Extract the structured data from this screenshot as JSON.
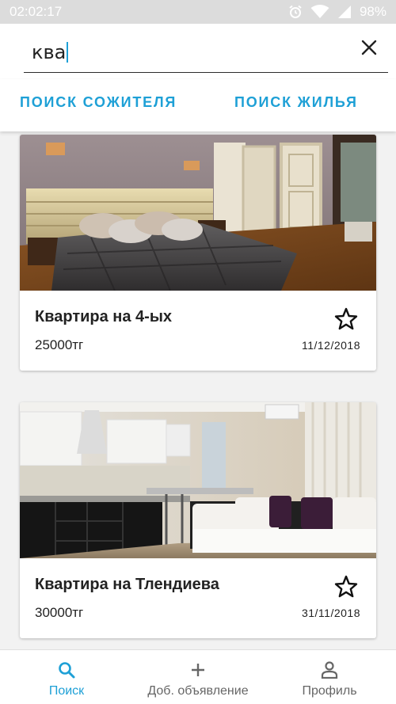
{
  "status_bar": {
    "time": "02:02:17",
    "battery": "98%",
    "icons": [
      "alarm-icon",
      "wifi-icon",
      "signal-icon",
      "battery-icon"
    ]
  },
  "search": {
    "value": "ква",
    "clear_icon": "close-icon"
  },
  "tabs": {
    "roommate": "Поиск сожителя",
    "housing": "Поиск жилья"
  },
  "listings": [
    {
      "title": "Квартира на 4-ых",
      "price": "25000тг",
      "date": "11/12/2018",
      "favorite_icon": "star-outline-icon"
    },
    {
      "title": "Квартира на Тлендиева",
      "price": "30000тг",
      "date": "31/11/2018",
      "favorite_icon": "star-outline-icon"
    }
  ],
  "nav": {
    "search": "Поиск",
    "add": "Доб. объявление",
    "profile": "Профиль"
  },
  "colors": {
    "accent": "#1ea0d6",
    "status_bar": "#dcdcdc"
  }
}
